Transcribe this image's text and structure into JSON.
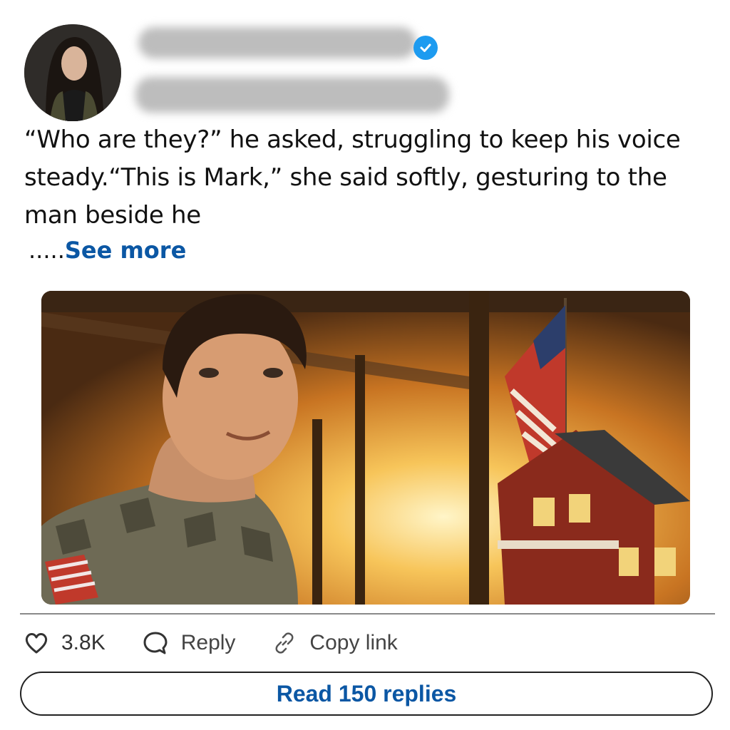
{
  "post": {
    "text": "“Who are they?” he asked, struggling to keep his voice steady.“This is Mark,” she said softly, gesturing to the man beside he",
    "ellipsis": ".....",
    "see_more": "See more"
  },
  "image": {
    "description_icon": "soldier-porch-sunset-photo"
  },
  "actions": {
    "likes": "3.8K",
    "reply": "Reply",
    "copy_link": "Copy link",
    "read_replies": "Read 150 replies"
  },
  "colors": {
    "link": "#0b57a4",
    "verified": "#1d9bf0"
  }
}
